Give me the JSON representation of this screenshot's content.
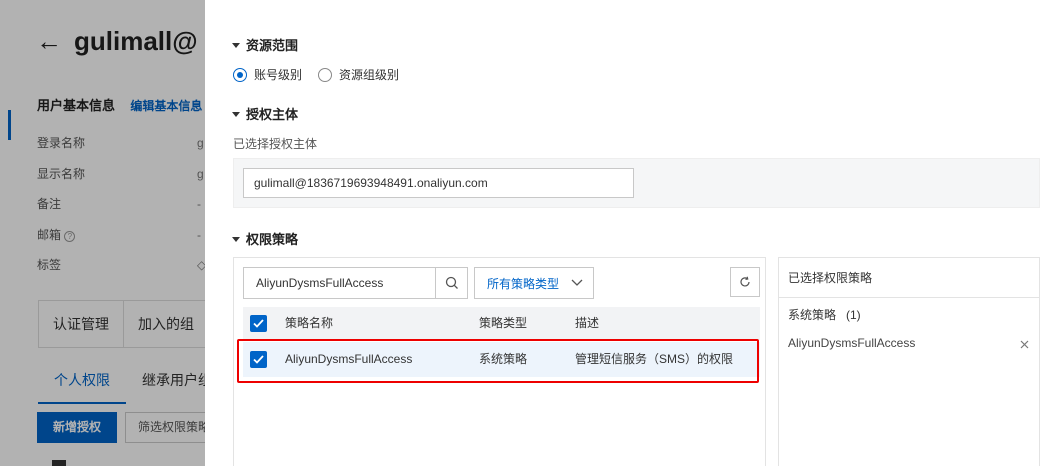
{
  "background": {
    "title": "gulimall@",
    "basic_info_heading": "用户基本信息",
    "edit_basic_info": "编辑基本信息",
    "fields": [
      {
        "key": "登录名称",
        "value": "g"
      },
      {
        "key": "显示名称",
        "value": "g"
      },
      {
        "key": "备注",
        "value": "-"
      },
      {
        "key": "邮箱",
        "value": "-"
      },
      {
        "key": "标签",
        "value": ""
      }
    ],
    "tabs_top": [
      "认证管理",
      "加入的组"
    ],
    "tabs_bottom": [
      "个人权限",
      "继承用户组"
    ],
    "add_grant_button": "新增授权",
    "filter_placeholder": "筛选权限策略"
  },
  "drawer": {
    "resource_scope": {
      "title": "资源范围",
      "options": [
        {
          "label": "账号级别",
          "checked": true
        },
        {
          "label": "资源组级别",
          "checked": false
        }
      ]
    },
    "principal": {
      "title": "授权主体",
      "selected_label": "已选择授权主体",
      "value": "gulimall@1836719693948491.onaliyun.com"
    },
    "policy": {
      "title": "权限策略",
      "search_value": "AliyunDysmsFullAccess",
      "type_select": "所有策略类型",
      "columns": [
        "策略名称",
        "策略类型",
        "描述"
      ],
      "rows": [
        {
          "name": "AliyunDysmsFullAccess",
          "type": "系统策略",
          "desc": "管理短信服务（SMS）的权限",
          "checked": true
        }
      ]
    },
    "selected_policies": {
      "title": "已选择权限策略",
      "group_label": "系统策略",
      "group_count": "(1)",
      "items": [
        "AliyunDysmsFullAccess"
      ]
    }
  },
  "colors": {
    "primary": "#0064c8",
    "highlight_border": "#e00000"
  }
}
